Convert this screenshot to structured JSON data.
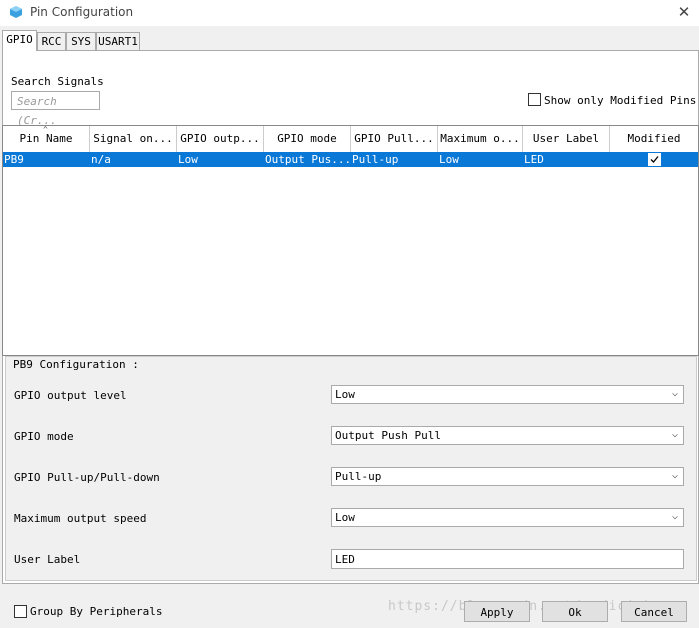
{
  "window": {
    "title": "Pin Configuration"
  },
  "tabs": [
    "GPIO",
    "RCC",
    "SYS",
    "USART1"
  ],
  "search": {
    "label": "Search Signals",
    "placeholder": "Search (Cr..."
  },
  "show_modified": {
    "label": "Show only Modified Pins",
    "checked": false
  },
  "table": {
    "headers": [
      "Pin Name",
      "Signal on...",
      "GPIO outp...",
      "GPIO mode",
      "GPIO Pull...",
      "Maximum o...",
      "User Label",
      "Modified"
    ],
    "rows": [
      {
        "pin": "PB9",
        "signal": "n/a",
        "output": "Low",
        "mode": "Output Pus...",
        "pull": "Pull-up",
        "speed": "Low",
        "label": "LED",
        "modified": true
      }
    ]
  },
  "config": {
    "title": "PB9 Configuration :",
    "fields": [
      {
        "label": "GPIO output level",
        "value": "Low"
      },
      {
        "label": "GPIO mode",
        "value": "Output Push Pull"
      },
      {
        "label": "GPIO Pull-up/Pull-down",
        "value": "Pull-up"
      },
      {
        "label": "Maximum output speed",
        "value": "Low"
      },
      {
        "label": "User Label",
        "value": "LED"
      }
    ]
  },
  "group_by": {
    "label": "Group By Peripherals",
    "checked": false
  },
  "watermark": "https://blog.csdn.net/medicinh",
  "buttons": {
    "apply": "Apply",
    "ok": "Ok",
    "cancel": "Cancel"
  },
  "colors": {
    "selection": "#0a78d7",
    "background": "#f0f0f0"
  }
}
